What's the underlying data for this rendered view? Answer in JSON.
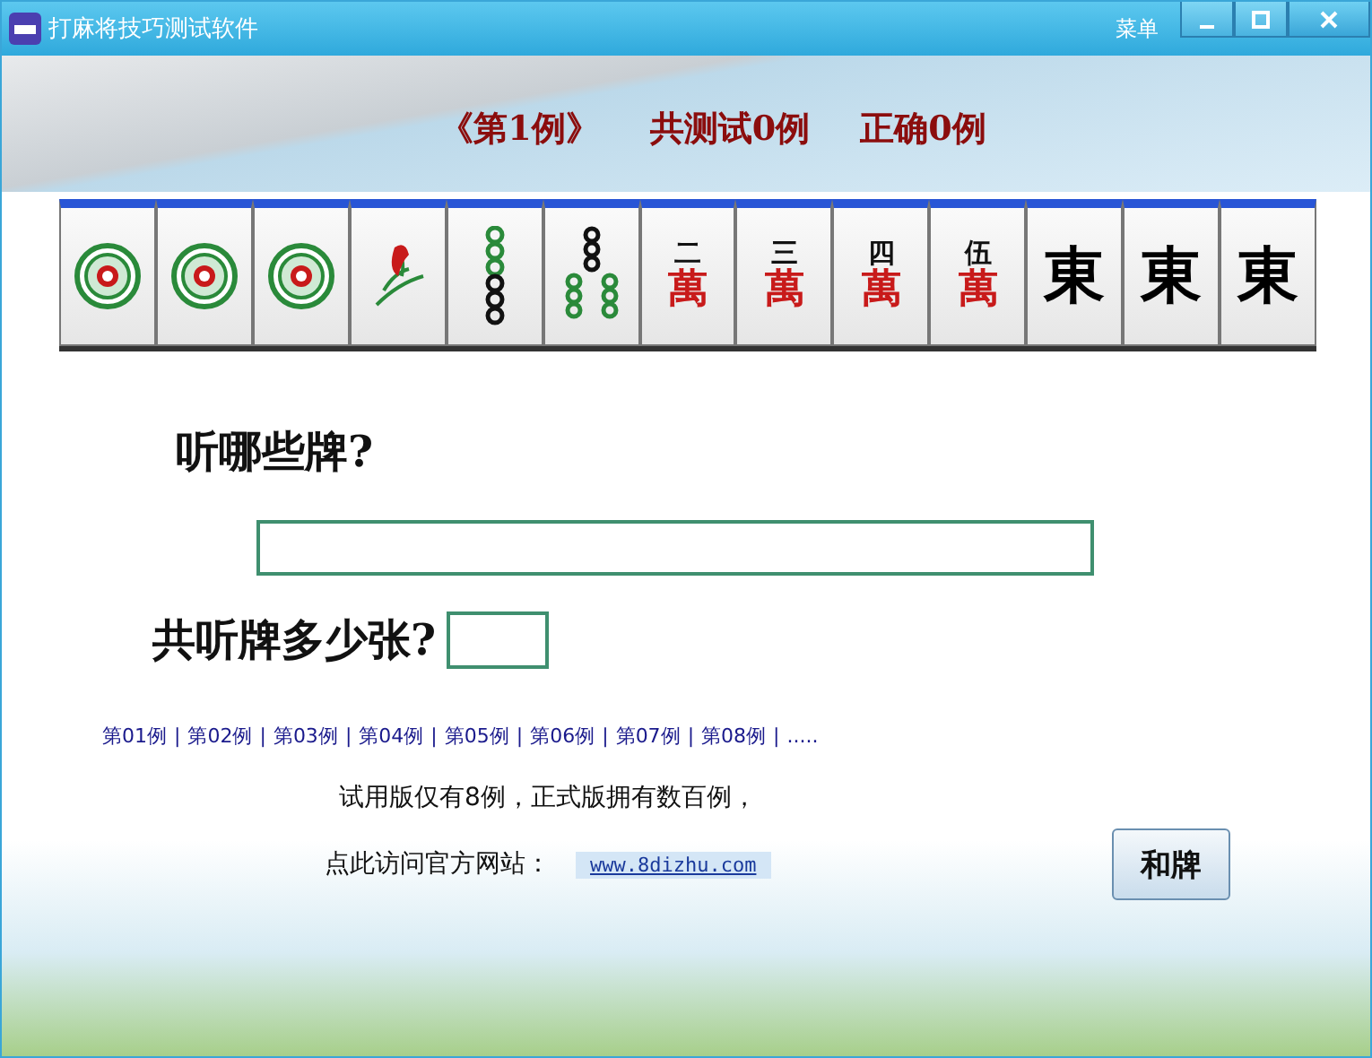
{
  "window": {
    "title": "打麻将技巧测试软件",
    "menu": "菜单"
  },
  "header": {
    "example": "《第1例》",
    "total": "共测试0例",
    "correct": "正确0例"
  },
  "tiles": [
    {
      "kind": "one-circle"
    },
    {
      "kind": "one-circle"
    },
    {
      "kind": "one-circle"
    },
    {
      "kind": "one-bamboo"
    },
    {
      "kind": "two-bamboo"
    },
    {
      "kind": "three-bamboo"
    },
    {
      "kind": "character",
      "number": "二",
      "suit": "萬"
    },
    {
      "kind": "character",
      "number": "三",
      "suit": "萬"
    },
    {
      "kind": "character",
      "number": "四",
      "suit": "萬"
    },
    {
      "kind": "character",
      "number": "伍",
      "suit": "萬"
    },
    {
      "kind": "honor",
      "glyph": "東"
    },
    {
      "kind": "honor",
      "glyph": "東"
    },
    {
      "kind": "honor",
      "glyph": "東"
    }
  ],
  "question1": "听哪些牌?",
  "question2": "共听牌多少张?",
  "examples": [
    "第01例",
    "第02例",
    "第03例",
    "第04例",
    "第05例",
    "第06例",
    "第07例",
    "第08例"
  ],
  "examples_more": ".....",
  "separator": "|",
  "notice": "试用版仅有8例，正式版拥有数百例，",
  "visit_label": "点此访问官方网站：",
  "site_link": "www.8dizhu.com",
  "submit": "和牌"
}
